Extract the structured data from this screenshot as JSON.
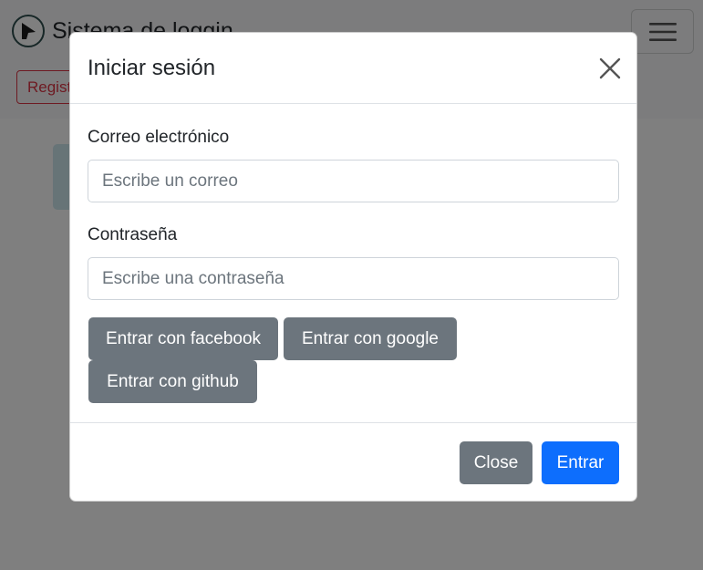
{
  "navbar": {
    "brand_text": "Sistema de loggin",
    "register_label": "Registrarse"
  },
  "modal": {
    "title": "Iniciar sesión",
    "email": {
      "label": "Correo electrónico",
      "placeholder": "Escribe un correo",
      "value": ""
    },
    "password": {
      "label": "Contraseña",
      "placeholder": "Escribe una contraseña",
      "value": ""
    },
    "social_buttons": {
      "facebook": "Entrar con facebook",
      "google": "Entrar con google",
      "github": "Entrar con github"
    },
    "footer": {
      "close_label": "Close",
      "submit_label": "Entrar"
    }
  },
  "icons": {
    "brand": "brand-logo-icon",
    "toggler": "hamburger-menu-icon",
    "close": "close-icon"
  },
  "colors": {
    "primary": "#0d6efd",
    "secondary": "#6c757d",
    "danger": "#dc3545",
    "backdrop": "rgba(0,0,0,0.5)"
  }
}
